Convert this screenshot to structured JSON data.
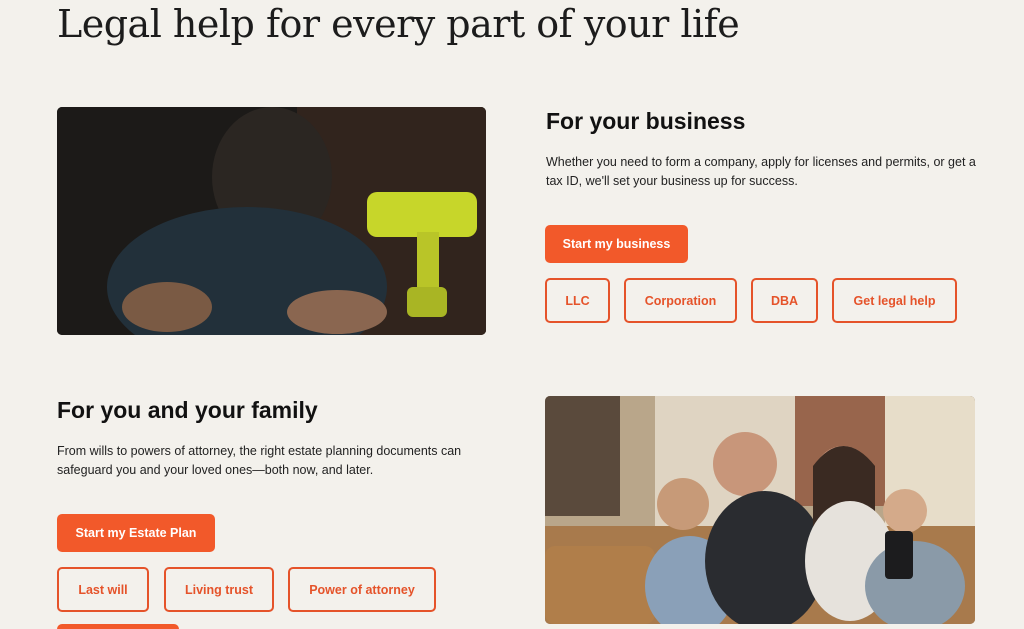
{
  "page": {
    "title": "Legal help for every part of your life"
  },
  "business": {
    "heading": "For your business",
    "description": "Whether you need to form a company, apply for licenses and permits, or get a tax ID, we'll set your business up for success.",
    "primary_button": "Start my business",
    "links": [
      "LLC",
      "Corporation",
      "DBA",
      "Get legal help"
    ]
  },
  "family": {
    "heading": "For you and your family",
    "description": "From wills to powers of attorney, the right estate planning documents can safeguard you and your loved ones—both now, and later.",
    "primary_button": "Start my Estate Plan",
    "links": [
      "Last will",
      "Living trust",
      "Power of attorney"
    ]
  },
  "colors": {
    "accent": "#f2592a",
    "background": "#f3f1ec"
  }
}
